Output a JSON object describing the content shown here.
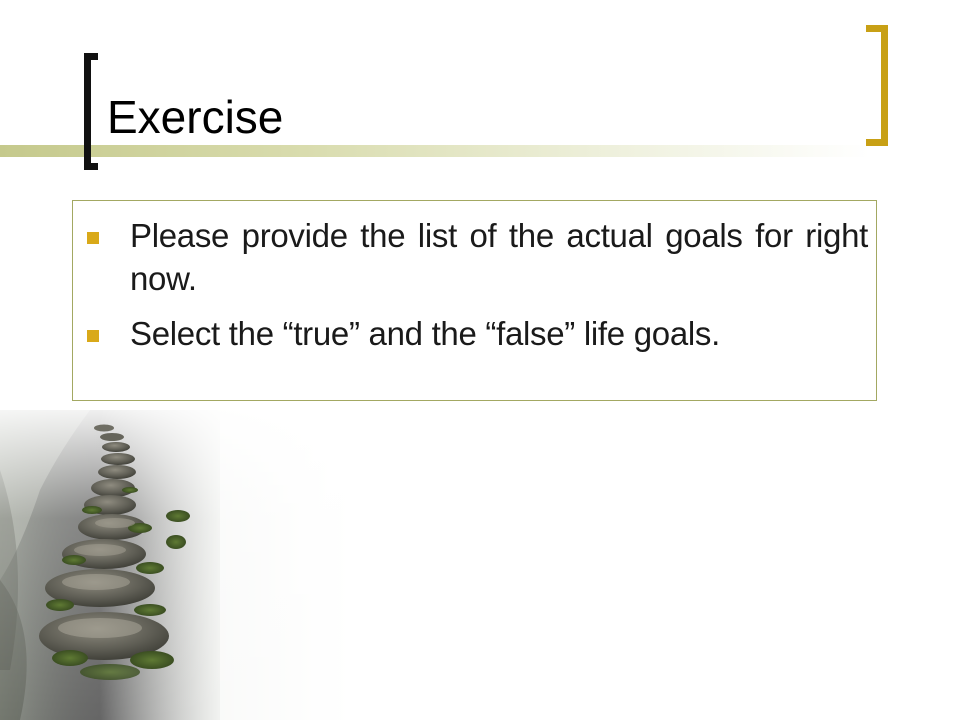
{
  "slide": {
    "title": "Exercise",
    "bullets": [
      {
        "text": "Please provide the list of the actual goals for right now."
      },
      {
        "text": "Select the “true” and the “false” life goals."
      }
    ]
  },
  "colors": {
    "left_bracket": "#111111",
    "right_bracket": "#c8a015",
    "bullet_marker": "#d9a919",
    "content_border": "#a3a862",
    "title_band": "#c5c98c"
  },
  "image": {
    "subject": "stepping-stones"
  }
}
